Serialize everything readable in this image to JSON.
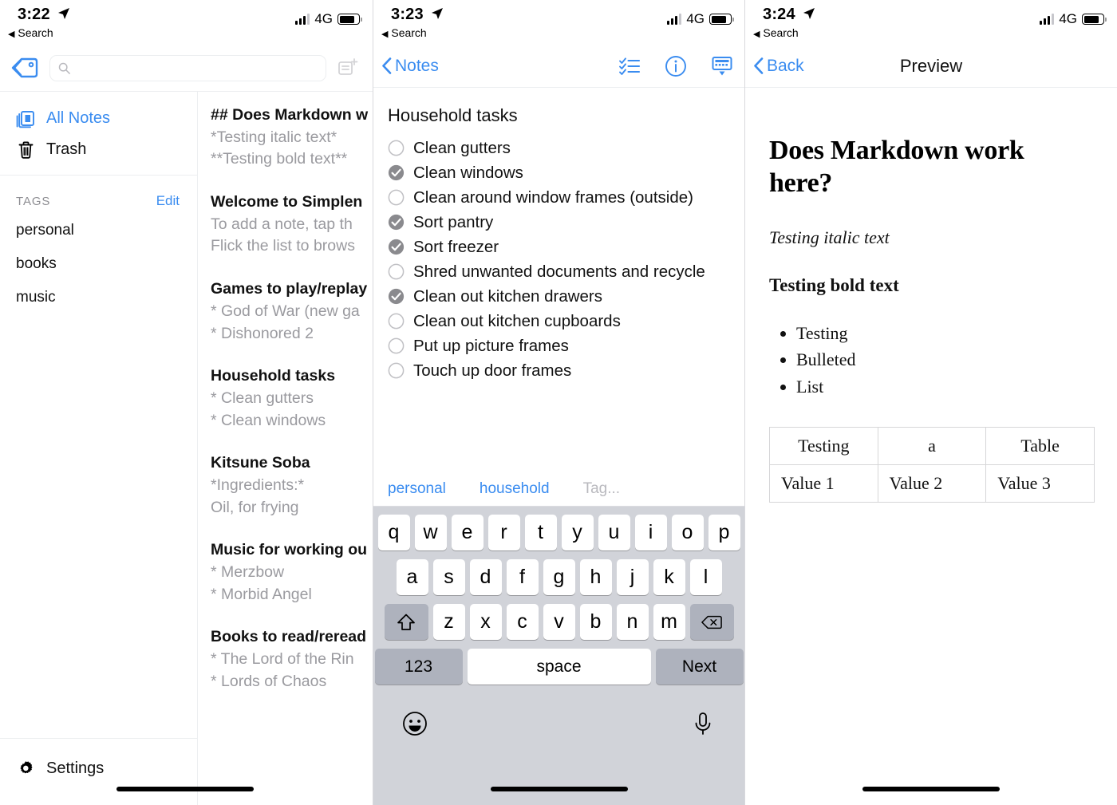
{
  "panels": [
    {
      "status": {
        "time": "3:22",
        "back_label": "Search",
        "network": "4G"
      },
      "toolbar": {
        "search_placeholder": "",
        "tag_icon": "tag-icon",
        "new_note_icon": "new-note-icon"
      },
      "sidebar": {
        "items": [
          {
            "label": "All Notes",
            "icon": "notes-stack-icon",
            "active": true
          },
          {
            "label": "Trash",
            "icon": "trash-icon",
            "active": false
          }
        ],
        "tags_header": "TAGS",
        "tags_edit": "Edit",
        "tags": [
          "personal",
          "books",
          "music"
        ],
        "settings_label": "Settings",
        "settings_icon": "gear-icon"
      },
      "notes": [
        {
          "title": "## Does Markdown w",
          "lines": [
            "*Testing italic text*",
            "**Testing bold text**"
          ]
        },
        {
          "title": "Welcome to Simplen",
          "lines": [
            "To add a note, tap th",
            "Flick the list to brows"
          ]
        },
        {
          "title": "Games to play/replay",
          "lines": [
            "* God of War (new ga",
            "* Dishonored 2"
          ]
        },
        {
          "title": "Household tasks",
          "lines": [
            "* Clean gutters",
            "* Clean windows"
          ]
        },
        {
          "title": "Kitsune Soba",
          "lines": [
            "*Ingredients:*",
            "Oil, for frying"
          ]
        },
        {
          "title": "Music for working ou",
          "lines": [
            "* Merzbow",
            "* Morbid Angel"
          ]
        },
        {
          "title": "Books to read/reread",
          "lines": [
            "* The Lord of the Rin",
            "* Lords of Chaos"
          ]
        }
      ]
    },
    {
      "status": {
        "time": "3:23",
        "back_label": "Search",
        "network": "4G"
      },
      "nav": {
        "back_label": "Notes",
        "icons": [
          {
            "name": "checklist-icon"
          },
          {
            "name": "info-icon"
          },
          {
            "name": "hide-keyboard-icon"
          }
        ]
      },
      "note": {
        "heading": "Household tasks",
        "items": [
          {
            "label": "Clean gutters",
            "checked": false
          },
          {
            "label": "Clean windows",
            "checked": true
          },
          {
            "label": "Clean around window frames (outside)",
            "checked": false
          },
          {
            "label": "Sort pantry",
            "checked": true
          },
          {
            "label": "Sort freezer",
            "checked": true
          },
          {
            "label": "Shred unwanted documents and recycle",
            "checked": false
          },
          {
            "label": "Clean out kitchen drawers",
            "checked": true
          },
          {
            "label": "Clean out kitchen cupboards",
            "checked": false
          },
          {
            "label": "Put up picture frames",
            "checked": false
          },
          {
            "label": "Touch up door frames",
            "checked": false
          }
        ]
      },
      "tagbar": {
        "tags": [
          "personal",
          "household"
        ],
        "placeholder": "Tag..."
      },
      "keyboard": {
        "row1": [
          "q",
          "w",
          "e",
          "r",
          "t",
          "y",
          "u",
          "i",
          "o",
          "p"
        ],
        "row2": [
          "a",
          "s",
          "d",
          "f",
          "g",
          "h",
          "j",
          "k",
          "l"
        ],
        "row3": [
          "z",
          "x",
          "c",
          "v",
          "b",
          "n",
          "m"
        ],
        "shift_icon": "shift-icon",
        "backspace_icon": "backspace-icon",
        "numbers_label": "123",
        "space_label": "space",
        "next_label": "Next",
        "emoji_icon": "emoji-icon",
        "mic_icon": "microphone-icon"
      }
    },
    {
      "status": {
        "time": "3:24",
        "back_label": "Search",
        "network": "4G"
      },
      "nav": {
        "back_label": "Back",
        "title": "Preview"
      },
      "preview": {
        "heading": "Does Markdown work here?",
        "italic": "Testing italic text",
        "bold": "Testing bold text",
        "bullets": [
          "Testing",
          "Bulleted",
          "List"
        ],
        "table": {
          "headers": [
            "Testing",
            "a",
            "Table"
          ],
          "rows": [
            [
              "Value 1",
              "Value 2",
              "Value 3"
            ]
          ]
        }
      }
    }
  ],
  "colors": {
    "accent": "#3a8cf0",
    "checked": "#8a8a8e",
    "muted": "#9a9a9f",
    "keyboard_bg": "#d1d3d9"
  }
}
